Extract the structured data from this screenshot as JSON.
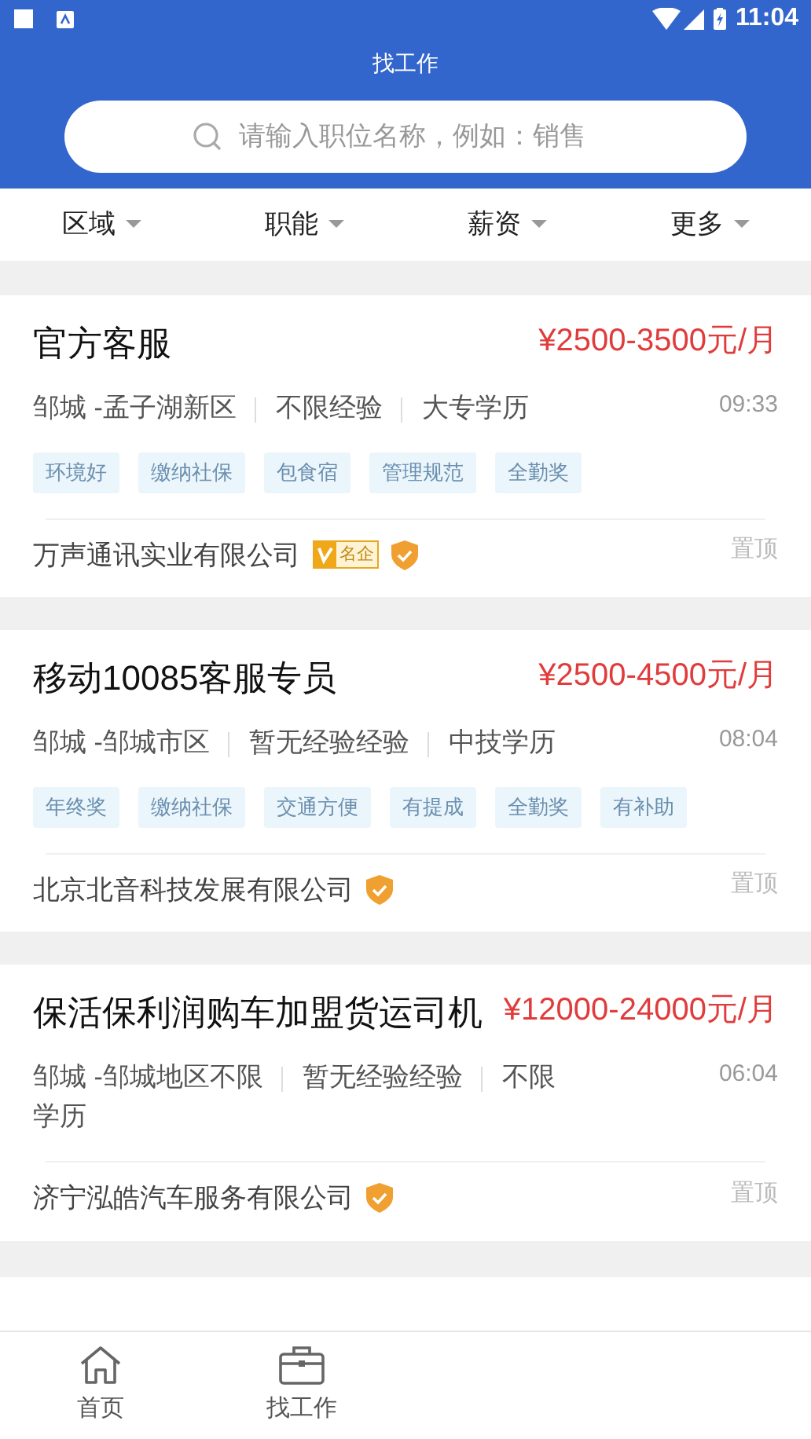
{
  "status_bar": {
    "time": "11:04"
  },
  "header": {
    "title": "找工作",
    "search": {
      "placeholder": "请输入职位名称，例如：销售"
    }
  },
  "filters": [
    {
      "label": "区域"
    },
    {
      "label": "职能"
    },
    {
      "label": "薪资"
    },
    {
      "label": "更多"
    }
  ],
  "jobs": [
    {
      "title": "官方客服",
      "salary": "¥2500-3500元/月",
      "location": "邹城 -孟子湖新区",
      "experience": "不限经验",
      "education": "大专学历",
      "time": "09:33",
      "tags": [
        "环境好",
        "缴纳社保",
        "包食宿",
        "管理规范",
        "全勤奖"
      ],
      "company": "万声通讯实业有限公司",
      "famous_badge": "名企",
      "verified": true,
      "pin": "置顶"
    },
    {
      "title": "移动10085客服专员",
      "salary": "¥2500-4500元/月",
      "location": "邹城 -邹城市区",
      "experience": "暂无经验经验",
      "education": "中技学历",
      "time": "08:04",
      "tags": [
        "年终奖",
        "缴纳社保",
        "交通方便",
        "有提成",
        "全勤奖",
        "有补助"
      ],
      "company": "北京北音科技发展有限公司",
      "verified": true,
      "pin": "置顶"
    },
    {
      "title": "保活保利润购车加盟货运司机",
      "salary": "¥12000-24000元/月",
      "location": "邹城 -邹城地区不限",
      "experience": "暂无经验经验",
      "education": "不限学历",
      "time": "06:04",
      "company": "济宁泓皓汽车服务有限公司",
      "verified": true,
      "pin": "置顶"
    }
  ],
  "bottom_nav": [
    {
      "label": "首页",
      "kind": "home",
      "selected": false
    },
    {
      "label": "找工作",
      "kind": "jobs",
      "selected": false
    }
  ]
}
